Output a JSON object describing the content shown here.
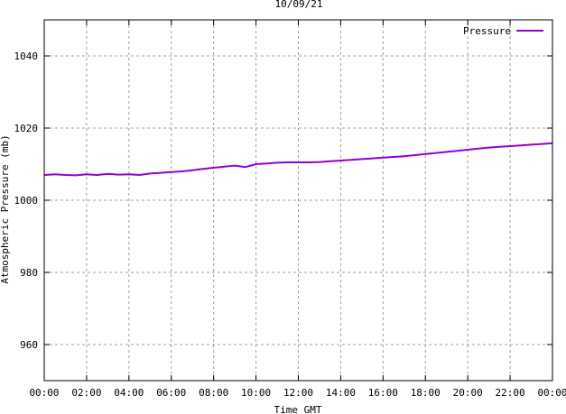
{
  "chart_data": {
    "type": "line",
    "title": "10/09/21",
    "xlabel": "Time GMT",
    "ylabel": "Atmospheric Pressure (mb)",
    "ylim": [
      950,
      1050
    ],
    "xlim": [
      0,
      24
    ],
    "y_ticks": [
      960,
      980,
      1000,
      1020,
      1040
    ],
    "x_tick_labels": [
      "00:00",
      "02:00",
      "04:00",
      "06:00",
      "08:00",
      "10:00",
      "12:00",
      "14:00",
      "16:00",
      "18:00",
      "20:00",
      "22:00",
      "00:00"
    ],
    "grid": true,
    "legend_position": "top-right",
    "series": [
      {
        "name": "Pressure",
        "color": "#9400d3",
        "x": [
          0,
          0.5,
          1,
          1.5,
          2,
          2.5,
          3,
          3.5,
          4,
          4.5,
          5,
          5.5,
          6,
          6.5,
          7,
          7.5,
          8,
          8.5,
          9,
          9.5,
          10,
          10.5,
          11,
          11.5,
          12,
          12.5,
          13,
          13.5,
          14,
          14.5,
          15,
          15.5,
          16,
          16.5,
          17,
          17.5,
          18,
          18.5,
          19,
          19.5,
          20,
          20.5,
          21,
          21.5,
          22,
          22.5,
          23,
          23.5,
          24
        ],
        "y": [
          1007.0,
          1007.2,
          1007.0,
          1006.9,
          1007.2,
          1007.0,
          1007.3,
          1007.1,
          1007.2,
          1007.0,
          1007.4,
          1007.6,
          1007.8,
          1008.0,
          1008.3,
          1008.7,
          1009.0,
          1009.3,
          1009.6,
          1009.2,
          1010.0,
          1010.2,
          1010.4,
          1010.5,
          1010.5,
          1010.5,
          1010.6,
          1010.8,
          1011.0,
          1011.2,
          1011.4,
          1011.6,
          1011.8,
          1012.0,
          1012.2,
          1012.5,
          1012.8,
          1013.1,
          1013.4,
          1013.7,
          1014.0,
          1014.3,
          1014.6,
          1014.8,
          1015.0,
          1015.2,
          1015.4,
          1015.6,
          1015.8
        ]
      }
    ]
  }
}
